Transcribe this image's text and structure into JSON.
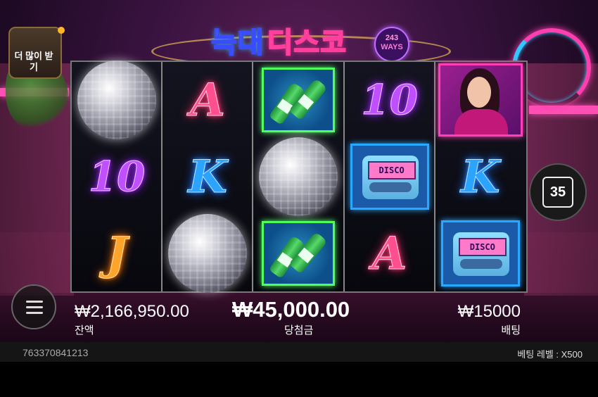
{
  "game": {
    "title_part1": "늑대",
    "title_part2": "디스코",
    "ways_number": "243",
    "ways_label": "WAYS"
  },
  "more_button": {
    "label": "더 많이 받기"
  },
  "reels": [
    [
      "disco-ball",
      "10",
      "J"
    ],
    [
      "A",
      "K",
      "disco-ball"
    ],
    [
      "soju-bottles",
      "disco-ball",
      "soju-bottles"
    ],
    [
      "10",
      "disco-pager",
      "A"
    ],
    [
      "disco-lady",
      "K",
      "disco-pager"
    ]
  ],
  "pager_screen_text": "DISCO",
  "scatter_button": {
    "value": "35"
  },
  "hud": {
    "balance_value": "₩2,166,950.00",
    "balance_label": "잔액",
    "win_value": "₩45,000.00",
    "win_label": "당첨금",
    "bet_value": "₩15000",
    "bet_label": "배팅"
  },
  "footer": {
    "round_id": "763370841213",
    "bet_level": "베팅 레벨 : X500"
  },
  "colors": {
    "accent_pink": "#ff3fae",
    "accent_blue": "#35c6ff",
    "title_yellow": "#ffe54a"
  }
}
